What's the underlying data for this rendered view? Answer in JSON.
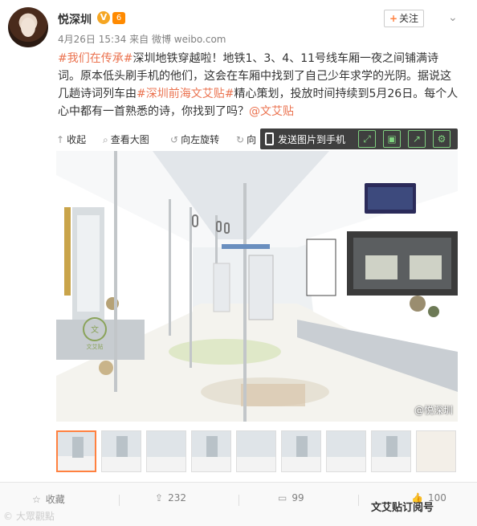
{
  "header": {
    "author": "悦深圳",
    "verified_badge": "V",
    "level_badge": "6",
    "timestamp": "4月26日 15:34",
    "source": "来自 微博 weibo.com",
    "follow_plus": "+",
    "follow_label": "关注",
    "more_arrow": "⌄"
  },
  "post": {
    "hashtag1": "#我们在传承#",
    "text1": "深圳地铁穿越啦！地铁1、3、4、11号线车厢一夜之间铺满诗词。原本低头刷手机的他们，这会在车厢中找到了自己少年求学的光阴。据说这几趟诗词列车由",
    "hashtag2": "#深圳前海文艾贴#",
    "text2": "精心策划，投放时间持续到5月26日。每个人心中都有一首熟悉的诗，你找到了吗？",
    "mention": "@文艾贴"
  },
  "toolbar": {
    "collapse": "收起",
    "view_large": "查看大图",
    "rotate_left": "向左旋转",
    "rotate_right": "向",
    "send_to_phone": "发送图片到手机"
  },
  "photo": {
    "watermark": "@悦深圳",
    "circle_logo_text": "文",
    "seat_text": "文艾贴"
  },
  "actions": {
    "favorite": "收藏",
    "repost_count": "232",
    "comment_count": "99",
    "like_count": "100"
  },
  "watermarks": {
    "left": "© 大眾觀點",
    "right": "文艾贴订阅号"
  },
  "colors": {
    "accent": "#eb7350",
    "follow_plus": "#ff8140",
    "toolbar_bg": "#3f3f3f",
    "toolbar_icon": "#7fd37f"
  }
}
